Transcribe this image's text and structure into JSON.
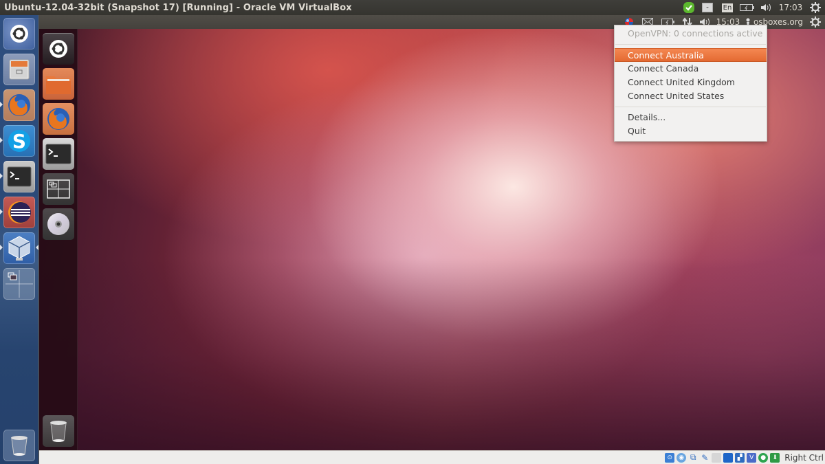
{
  "host": {
    "window_title": "Ubuntu-12.04-32bit (Snapshot 17) [Running] - Oracle VM VirtualBox",
    "tray": {
      "keyboard_layout": "En",
      "clock": "17:03"
    },
    "launcher": [
      {
        "name": "dash-home",
        "label": "Dash Home"
      },
      {
        "name": "files",
        "label": "Files"
      },
      {
        "name": "firefox",
        "label": "Firefox"
      },
      {
        "name": "skype",
        "label": "Skype"
      },
      {
        "name": "terminal",
        "label": "Terminal"
      },
      {
        "name": "eclipse",
        "label": "Eclipse"
      },
      {
        "name": "virtualbox",
        "label": "VirtualBox"
      },
      {
        "name": "workspace-switcher",
        "label": "Workspace Switcher"
      },
      {
        "name": "trash",
        "label": "Trash"
      }
    ]
  },
  "vm": {
    "panel": {
      "clock": "15:03",
      "user": "osboxes.org"
    },
    "launcher": [
      {
        "name": "dash-home",
        "label": "Dash Home"
      },
      {
        "name": "home-folder",
        "label": "Home Folder"
      },
      {
        "name": "firefox",
        "label": "Firefox"
      },
      {
        "name": "terminal",
        "label": "Terminal"
      },
      {
        "name": "workspace-switcher",
        "label": "Workspace Switcher"
      },
      {
        "name": "optical-drive",
        "label": "CD/DVD"
      },
      {
        "name": "trash",
        "label": "Trash"
      }
    ],
    "vpn_menu": {
      "status": "OpenVPN: 0 connections active",
      "items": [
        {
          "label": "Connect Australia",
          "active": true
        },
        {
          "label": "Connect Canada",
          "active": false
        },
        {
          "label": "Connect United Kingdom",
          "active": false
        },
        {
          "label": "Connect United States",
          "active": false
        }
      ],
      "details_label": "Details...",
      "quit_label": "Quit"
    },
    "statusbar": {
      "icons": [
        "hard-disk",
        "optical-disk",
        "network",
        "usb",
        "shared-folders",
        "display",
        "video-capture",
        "virtualization",
        "guest-additions",
        "mouse-integration"
      ],
      "host_key": "Right Ctrl"
    }
  },
  "colors": {
    "menu_highlight": "#e9753d",
    "host_panel": "#3c3b37",
    "vm_panel": "#4a4742"
  }
}
